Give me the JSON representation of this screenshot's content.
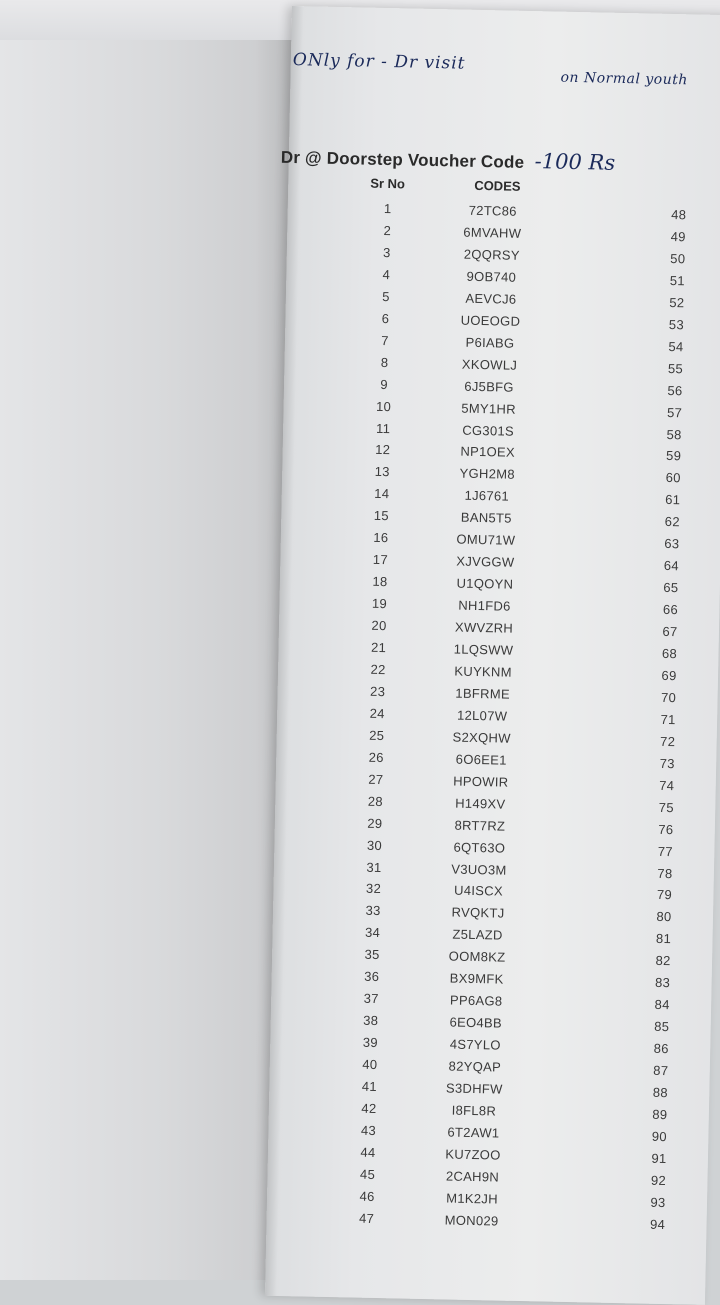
{
  "handwriting": {
    "line1": "ONly for - Dr visit",
    "line2": "on Normal youth",
    "price_note": "-100 Rs"
  },
  "title": "Dr @ Doorstep Voucher Code",
  "headers": {
    "sr": "Sr No",
    "codes": "CODES"
  },
  "rows": [
    {
      "sr": "1",
      "code": "72TC86",
      "right": "48"
    },
    {
      "sr": "2",
      "code": "6MVAHW",
      "right": "49"
    },
    {
      "sr": "3",
      "code": "2QQRSY",
      "right": "50"
    },
    {
      "sr": "4",
      "code": "9OB740",
      "right": "51"
    },
    {
      "sr": "5",
      "code": "AEVCJ6",
      "right": "52"
    },
    {
      "sr": "6",
      "code": "UOEOGD",
      "right": "53"
    },
    {
      "sr": "7",
      "code": "P6IABG",
      "right": "54"
    },
    {
      "sr": "8",
      "code": "XKOWLJ",
      "right": "55"
    },
    {
      "sr": "9",
      "code": "6J5BFG",
      "right": "56"
    },
    {
      "sr": "10",
      "code": "5MY1HR",
      "right": "57"
    },
    {
      "sr": "11",
      "code": "CG301S",
      "right": "58"
    },
    {
      "sr": "12",
      "code": "NP1OEX",
      "right": "59"
    },
    {
      "sr": "13",
      "code": "YGH2M8",
      "right": "60"
    },
    {
      "sr": "14",
      "code": "1J6761",
      "right": "61"
    },
    {
      "sr": "15",
      "code": "BAN5T5",
      "right": "62"
    },
    {
      "sr": "16",
      "code": "OMU71W",
      "right": "63"
    },
    {
      "sr": "17",
      "code": "XJVGGW",
      "right": "64"
    },
    {
      "sr": "18",
      "code": "U1QOYN",
      "right": "65"
    },
    {
      "sr": "19",
      "code": "NH1FD6",
      "right": "66"
    },
    {
      "sr": "20",
      "code": "XWVZRH",
      "right": "67"
    },
    {
      "sr": "21",
      "code": "1LQSWW",
      "right": "68"
    },
    {
      "sr": "22",
      "code": "KUYKNM",
      "right": "69"
    },
    {
      "sr": "23",
      "code": "1BFRME",
      "right": "70"
    },
    {
      "sr": "24",
      "code": "12L07W",
      "right": "71"
    },
    {
      "sr": "25",
      "code": "S2XQHW",
      "right": "72"
    },
    {
      "sr": "26",
      "code": "6O6EE1",
      "right": "73"
    },
    {
      "sr": "27",
      "code": "HPOWIR",
      "right": "74"
    },
    {
      "sr": "28",
      "code": "H149XV",
      "right": "75"
    },
    {
      "sr": "29",
      "code": "8RT7RZ",
      "right": "76"
    },
    {
      "sr": "30",
      "code": "6QT63O",
      "right": "77"
    },
    {
      "sr": "31",
      "code": "V3UO3M",
      "right": "78"
    },
    {
      "sr": "32",
      "code": "U4ISCX",
      "right": "79"
    },
    {
      "sr": "33",
      "code": "RVQKTJ",
      "right": "80"
    },
    {
      "sr": "34",
      "code": "Z5LAZD",
      "right": "81"
    },
    {
      "sr": "35",
      "code": "OOM8KZ",
      "right": "82"
    },
    {
      "sr": "36",
      "code": "BX9MFK",
      "right": "83"
    },
    {
      "sr": "37",
      "code": "PP6AG8",
      "right": "84"
    },
    {
      "sr": "38",
      "code": "6EO4BB",
      "right": "85"
    },
    {
      "sr": "39",
      "code": "4S7YLO",
      "right": "86"
    },
    {
      "sr": "40",
      "code": "82YQAP",
      "right": "87"
    },
    {
      "sr": "41",
      "code": "S3DHFW",
      "right": "88"
    },
    {
      "sr": "42",
      "code": "I8FL8R",
      "right": "89"
    },
    {
      "sr": "43",
      "code": "6T2AW1",
      "right": "90"
    },
    {
      "sr": "44",
      "code": "KU7ZOO",
      "right": "91"
    },
    {
      "sr": "45",
      "code": "2CAH9N",
      "right": "92"
    },
    {
      "sr": "46",
      "code": "M1K2JH",
      "right": "93"
    },
    {
      "sr": "47",
      "code": "MON029",
      "right": "94"
    }
  ]
}
